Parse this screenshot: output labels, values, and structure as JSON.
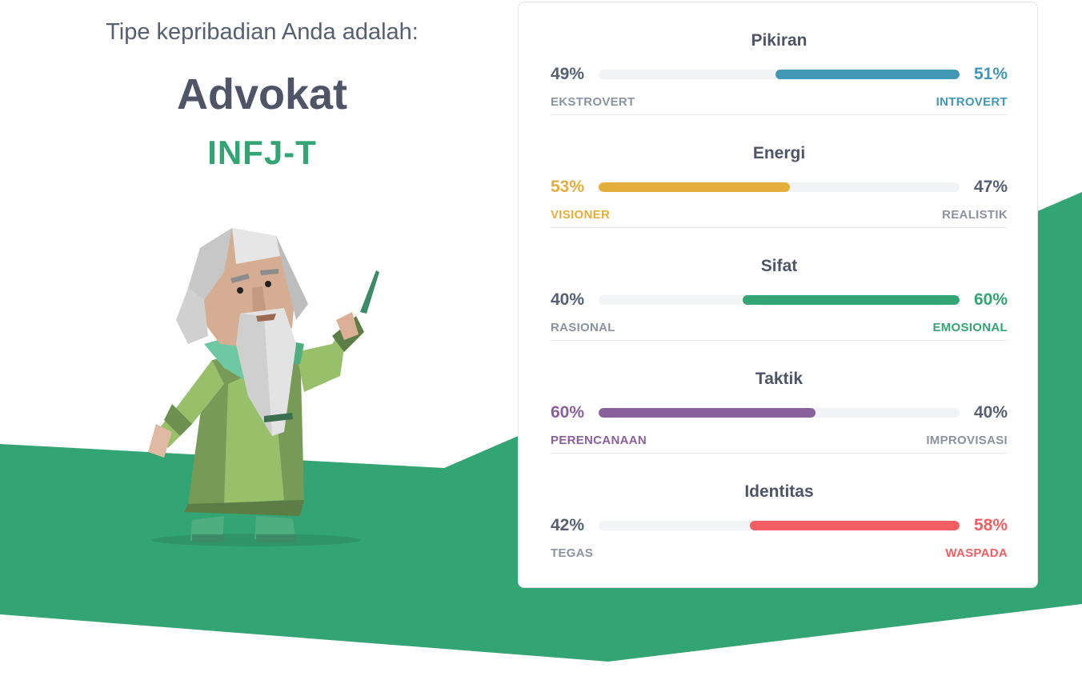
{
  "result": {
    "intro": "Tipe kepribadian Anda adalah:",
    "type_name": "Advokat",
    "type_code": "INFJ-T",
    "code_color": "#33a474",
    "avatar_icon": "advocate-sage-illustration"
  },
  "background_color": "#33a474",
  "traits": [
    {
      "title": "Pikiran",
      "left_pct": "49%",
      "right_pct": "51%",
      "left_label": "EKSTROVERT",
      "right_label": "INTROVERT",
      "dominant": "right",
      "dominant_value": 51,
      "color": "#4298b4"
    },
    {
      "title": "Energi",
      "left_pct": "53%",
      "right_pct": "47%",
      "left_label": "VISIONER",
      "right_label": "REALISTIK",
      "dominant": "left",
      "dominant_value": 53,
      "color": "#e4ae3a"
    },
    {
      "title": "Sifat",
      "left_pct": "40%",
      "right_pct": "60%",
      "left_label": "RASIONAL",
      "right_label": "EMOSIONAL",
      "dominant": "right",
      "dominant_value": 60,
      "color": "#33a474"
    },
    {
      "title": "Taktik",
      "left_pct": "60%",
      "right_pct": "40%",
      "left_label": "PERENCANAAN",
      "right_label": "IMPROVISASI",
      "dominant": "left",
      "dominant_value": 60,
      "color": "#88619a"
    },
    {
      "title": "Identitas",
      "left_pct": "42%",
      "right_pct": "58%",
      "left_label": "TEGAS",
      "right_label": "WASPADA",
      "dominant": "right",
      "dominant_value": 58,
      "color": "#f25e62"
    }
  ]
}
